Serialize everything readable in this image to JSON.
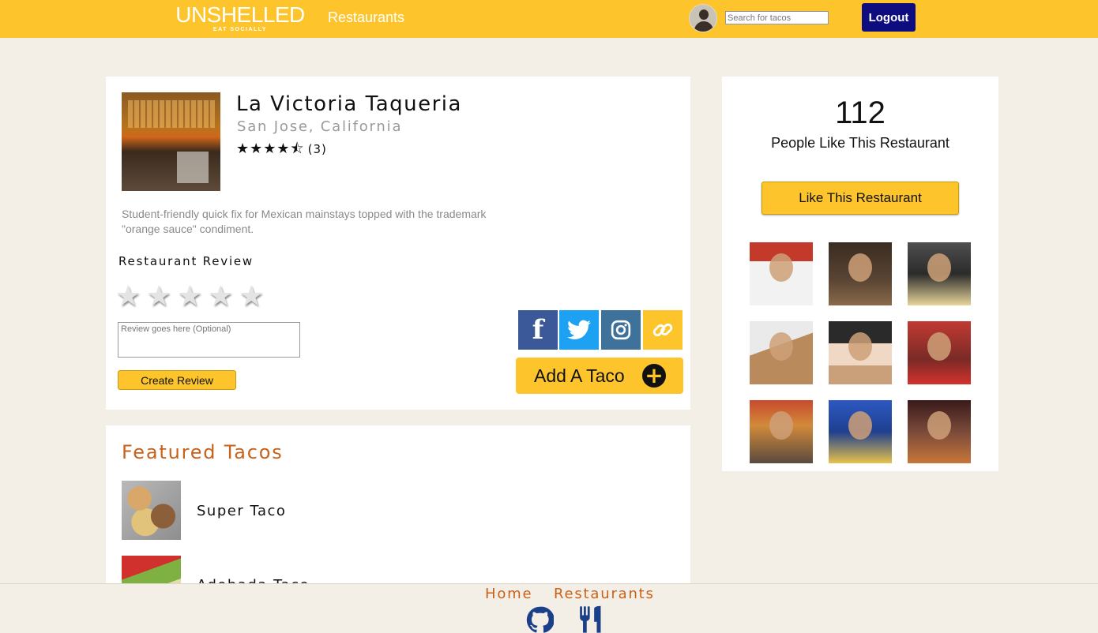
{
  "header": {
    "brand_name": "UNSHELLED",
    "brand_tagline": "EAT SOCIALLY",
    "nav_restaurants": "Restaurants",
    "search_placeholder": "Search for tacos",
    "logout_label": "Logout"
  },
  "restaurant": {
    "name": "La Victoria Taqueria",
    "location": "San Jose, California",
    "rating": 4.5,
    "rating_stars": "★★★★⯪",
    "review_count": "(3)",
    "description": "Student-friendly quick fix for Mexican mainstays topped with the trademark \"orange sauce\" condiment."
  },
  "review": {
    "heading": "Restaurant Review",
    "rating_input": 0,
    "textarea_placeholder": "Review goes here (Optional)",
    "submit_label": "Create Review"
  },
  "share": {
    "facebook_icon": "facebook-icon",
    "twitter_icon": "twitter-icon",
    "instagram_icon": "instagram-icon",
    "link_icon": "link-icon"
  },
  "add_taco": {
    "label": "Add A Taco",
    "icon": "plus-circle-icon"
  },
  "likes": {
    "count": "112",
    "label": "People Like This Restaurant",
    "button_label": "Like This Restaurant"
  },
  "featured": {
    "title": "Featured Tacos",
    "tacos": [
      {
        "name": "Super Taco"
      },
      {
        "name": "Adobada Taco"
      }
    ]
  },
  "footer": {
    "home_label": "Home",
    "restaurants_label": "Restaurants",
    "github_icon": "github-icon",
    "utensils_icon": "utensils-icon"
  },
  "colors": {
    "brand_yellow": "#fdc52b",
    "logout_navy": "#0d0d80",
    "accent_orange": "#c8611a",
    "page_bg": "#f4efe6"
  }
}
